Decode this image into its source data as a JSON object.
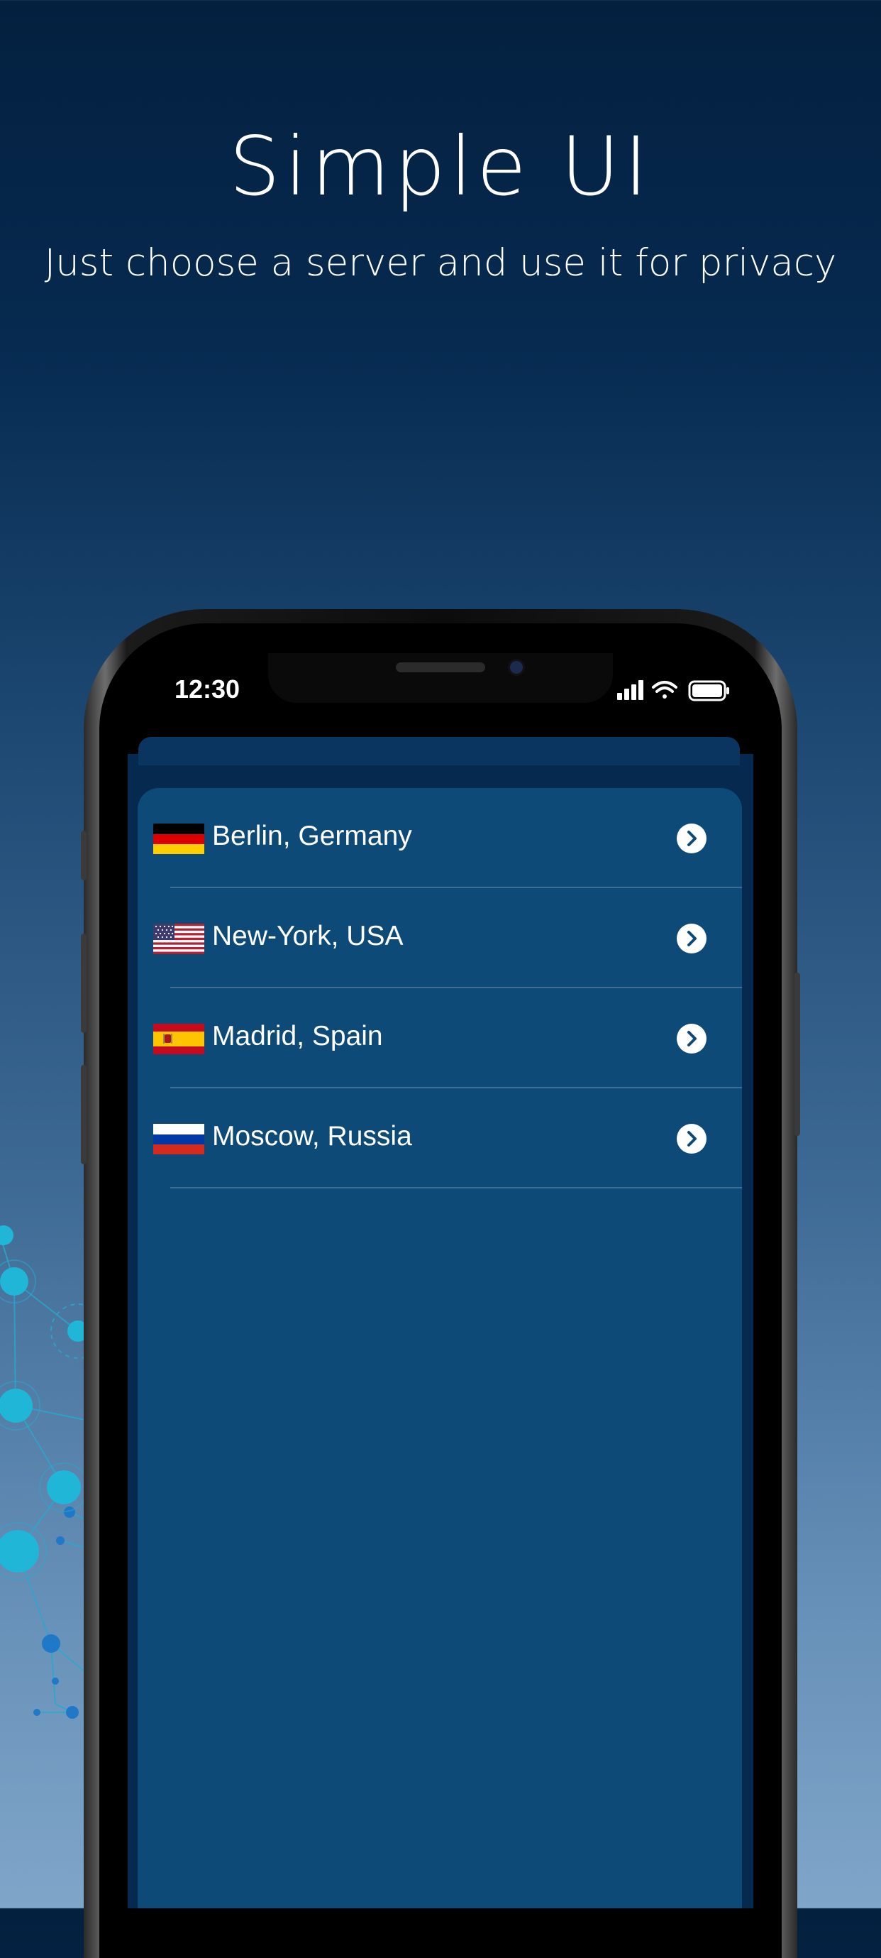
{
  "header": {
    "title": "Simple UI",
    "subtitle": "Just choose a server and use it for privacy"
  },
  "status_bar": {
    "time": "12:30"
  },
  "servers": [
    {
      "label": "Berlin, Germany",
      "flag_icon": "germany-flag-icon"
    },
    {
      "label": "New-York, USA",
      "flag_icon": "usa-flag-icon"
    },
    {
      "label": "Madrid, Spain",
      "flag_icon": "spain-flag-icon"
    },
    {
      "label": "Moscow, Russia",
      "flag_icon": "russia-flag-icon"
    }
  ],
  "colors": {
    "background_top": "#04203f",
    "background_bottom": "#7fa6c9",
    "list_background": "#0e4a77",
    "divider": "#3f6d93",
    "accent_network": "#1fb6d8"
  }
}
